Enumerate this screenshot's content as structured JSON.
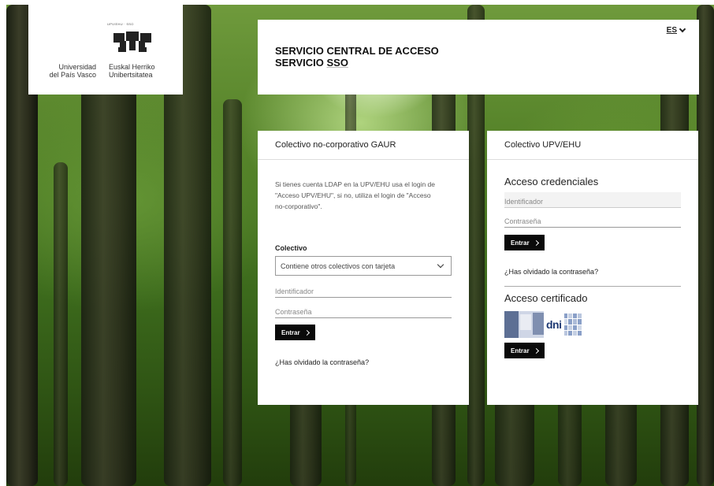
{
  "logo": {
    "tiny_text": "UPV/EHU · SSO",
    "left_text": [
      "Universidad",
      "del País Vasco"
    ],
    "right_text": [
      "Euskal Herriko",
      "Unibertsitatea"
    ]
  },
  "header": {
    "title_line1": "SERVICIO CENTRAL DE ACCESO",
    "title_line2_a": "SERVICIO ",
    "title_line2_b": "SSO",
    "language": "ES"
  },
  "left_panel": {
    "heading": "Colectivo no-corporativo GAUR",
    "description": "Si tienes cuenta LDAP en la UPV/EHU usa el login de \"Acceso UPV/EHU\", si no, utiliza el login de \"Acceso no-corporativo\".",
    "colectivo_label": "Colectivo",
    "colectivo_selected": "Contiene otros colectivos con tarjeta",
    "id_placeholder": "Identificador",
    "password_placeholder": "Contraseña",
    "submit_label": "Entrar",
    "forgot_link": "¿Has olvidado la contraseña?"
  },
  "right_panel": {
    "heading": "Colectivo UPV/EHU",
    "credentials_title": "Acceso credenciales",
    "id_placeholder": "Identificador",
    "password_placeholder": "Contraseña",
    "submit_label": "Entrar",
    "forgot_link": "¿Has olvidado la contraseña?",
    "certificate_title": "Acceso certificado",
    "dni_label": "dni",
    "certificate_submit_label": "Entrar"
  },
  "colors": {
    "button_bg": "#0a0a0a",
    "panel_bg": "#ffffff"
  }
}
